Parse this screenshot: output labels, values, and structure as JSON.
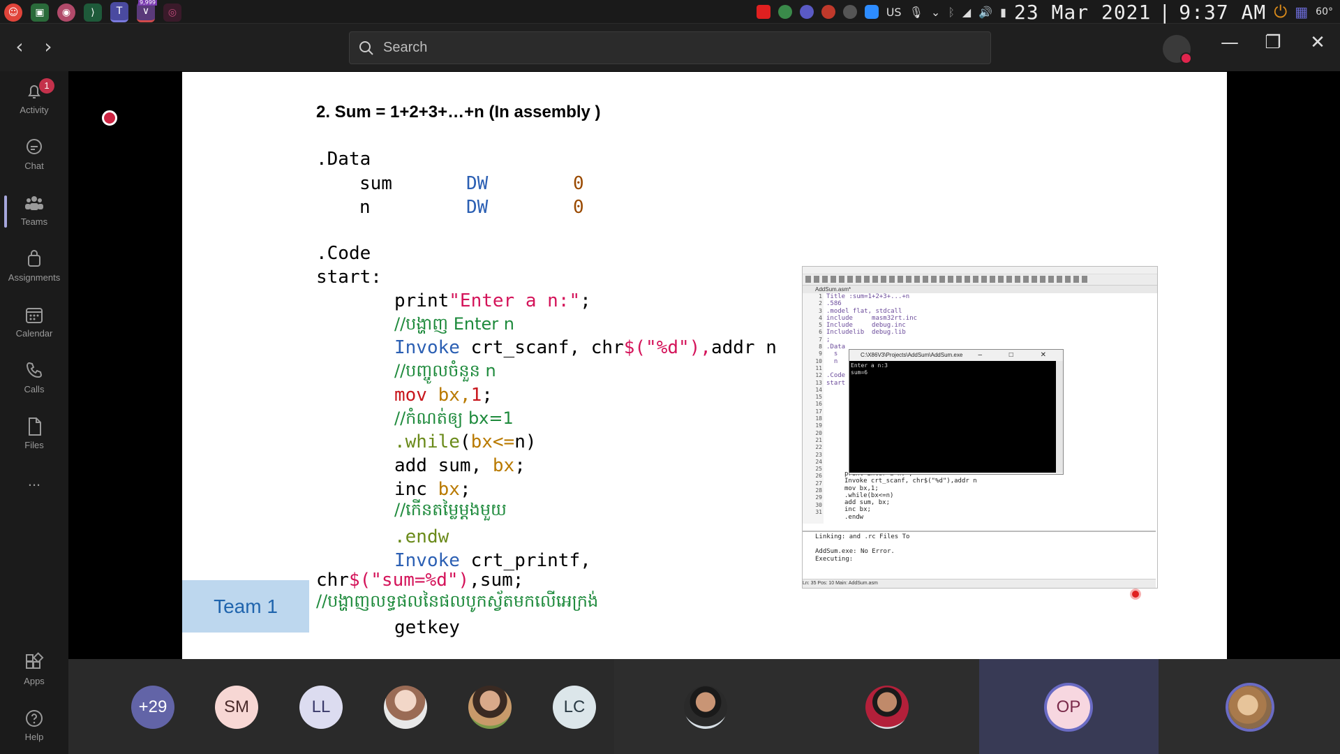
{
  "system_bar": {
    "keyboard_layout": "US",
    "date": "23 Mar 2021",
    "time": "9:37 AM",
    "temperature": "60°",
    "app_badge": "9,999"
  },
  "titlebar": {
    "search_placeholder": "Search"
  },
  "rail": {
    "items": [
      {
        "label": "Activity",
        "badge": "1"
      },
      {
        "label": "Chat"
      },
      {
        "label": "Teams"
      },
      {
        "label": "Assignments"
      },
      {
        "label": "Calendar"
      },
      {
        "label": "Calls"
      },
      {
        "label": "Files"
      },
      {
        "label": "..."
      }
    ],
    "bottom": [
      {
        "label": "Apps"
      },
      {
        "label": "Help"
      }
    ]
  },
  "slide": {
    "title": "2. Sum = 1+2+3+…+n (In assembly )",
    "data_section": ".Data",
    "vars": [
      {
        "name": "sum",
        "type": "DW",
        "value": "0"
      },
      {
        "name": "n",
        "type": "DW",
        "value": "0"
      }
    ],
    "code_section": ".Code",
    "start_label": "start:",
    "lines": {
      "print_kw": "print",
      "print_str": "\"Enter a n:\"",
      "print_end": ";",
      "cmt1": "//បង្ហាញ Enter n",
      "invoke1_kw": "Invoke",
      "invoke1_mid": " crt_scanf, chr",
      "invoke1_str": "$(\"%d\"),",
      "invoke1_end": "addr n",
      "cmt2": "//បញ្ចូលចំនួន n",
      "mov_kw": "mov",
      "mov_reg": " bx,",
      "mov_num": "1",
      "mov_end": ";",
      "cmt3": "//កំណត់ឲ្យ bx=1",
      "while_kw": ".while",
      "while_open": "(",
      "while_cond": "bx<=",
      "while_rest": "n)",
      "add_kw": "add sum, ",
      "add_reg": "bx",
      "add_end": ";",
      "inc_kw": "inc ",
      "inc_reg": "bx",
      "inc_end": ";",
      "cmt4": "//កើនតម្លៃម្តងមួយ",
      "endw": ".endw",
      "invoke2_kw": "Invoke",
      "invoke2_mid": " crt_printf,",
      "chr_kw": "chr",
      "chr_str": "$(\"sum=%d\")",
      "chr_end": ",sum;",
      "cmt5": "//បង្ហាញលទ្ធផលនៃផលបូកស្វ័តមកលើអេក្រង់",
      "getkey": "getkey"
    }
  },
  "screenshot": {
    "tab": "AddSum.asm*",
    "gutter": "1\n2\n3\n4\n5\n6\n7\n8\n9\n10\n11\n12\n13\n14\n15\n16\n17\n18\n19\n20\n21\n22\n23\n24\n25\n26\n27\n28\n29\n30\n31",
    "code_top": "Title :sum=1+2+3+...+n\n.586\n.model flat, stdcall\ninclude     masm32rt.inc\nInclude     debug.inc\nIncludelib  debug.lib\n;\n.Data\n  s\n  n\n\n.Code\nstart",
    "code_bottom": "print\"Enter a n:\";\nInvoke crt_scanf, chr$(\"%d\"),addr n\nmov bx,1;\n.while(bx<=n)\nadd sum, bx;\ninc bx;\n.endw",
    "console_title": "C:\\X86V3\\Projects\\AddSum\\AddSum.exe",
    "console_text": "Enter a n:3\nsum=6",
    "output": "Linking: and .rc Files To\n\nAddSum.exe: No Error.\nExecuting:",
    "status": "Ln: 35 Pos: 10        Main: AddSum.asm"
  },
  "team_label": "Team 1",
  "participants": [
    {
      "initials": "+29",
      "bg": "#6264a7",
      "fg": "#ffffff"
    },
    {
      "initials": "SM",
      "bg": "#f7d7d4",
      "fg": "#4a2a2a"
    },
    {
      "initials": "LL",
      "bg": "#dcdcf0",
      "fg": "#3a3a6a"
    },
    {
      "initials": "",
      "bg": "",
      "fg": ""
    },
    {
      "initials": "",
      "bg": "",
      "fg": ""
    },
    {
      "initials": "LC",
      "bg": "#dce6ea",
      "fg": "#2a3a44"
    },
    {
      "initials": "",
      "bg": "",
      "fg": ""
    },
    {
      "initials": "",
      "bg": "",
      "fg": ""
    },
    {
      "initials": "OP",
      "bg": "#f7d7e0",
      "fg": "#7a2a4a"
    },
    {
      "initials": "",
      "bg": "",
      "fg": ""
    }
  ],
  "colors": {
    "accent": "#6264a7",
    "comment_green": "#1e8a3c",
    "record_red": "#cc2442"
  }
}
